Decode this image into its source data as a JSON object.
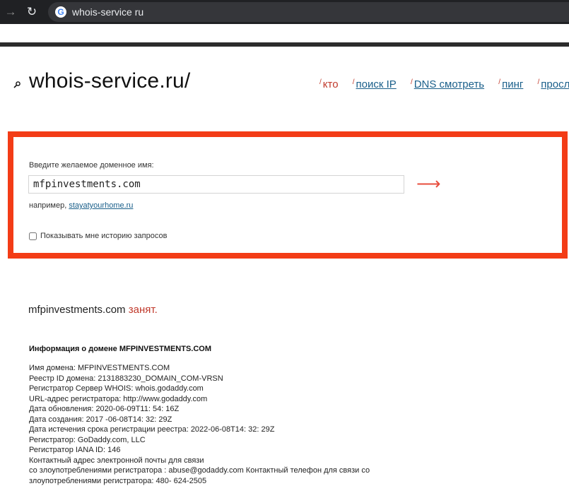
{
  "browser": {
    "url": "whois-service ru"
  },
  "site": {
    "title": "whois-service.ru/"
  },
  "nav": {
    "items": [
      {
        "label": "кто",
        "current": true
      },
      {
        "label": "поиск IP",
        "current": false
      },
      {
        "label": "DNS смотреть",
        "current": false
      },
      {
        "label": "пинг",
        "current": false
      },
      {
        "label": "просле",
        "current": false
      }
    ]
  },
  "search": {
    "label": "Введите желаемое доменное имя:",
    "value": "mfpinvestments.com",
    "example_prefix": "например,",
    "example_link": "stayatyourhome.ru",
    "history_label": "Показывать мне историю запросов",
    "history_checked": false
  },
  "result": {
    "domain": "mfpinvestments.com",
    "status": "занят",
    "period": "."
  },
  "info": {
    "heading": "Информация о домене MFPINVESTMENTS.COM",
    "lines": [
      "Имя домена: MFPINVESTMENTS.COM",
      "Реестр ID домена: 2131883230_DOMAIN_COM-VRSN",
      "Регистратор Сервер WHOIS: whois.godaddy.com",
      "URL-адрес регистратора: http://www.godaddy.com",
      "Дата обновления: 2020-06-09T11: 54: 16Z",
      "Дата создания: 2017 -06-08T14: 32: 29Z",
      "Дата истечения срока регистрации реестра: 2022-06-08T14: 32: 29Z",
      "Регистратор: GoDaddy.com, LLC",
      "Регистратор IANA ID: 146",
      "Контактный адрес электронной почты для связи",
      "со злоупотреблениями регистратора : abuse@godaddy.com Контактный телефон для связи со",
      "злоупотреблениями регистратора: 480- 624-2505"
    ]
  },
  "colors": {
    "accent_red": "#f33c16",
    "link_blue": "#1a5f8a",
    "status_red": "#c0392b"
  }
}
